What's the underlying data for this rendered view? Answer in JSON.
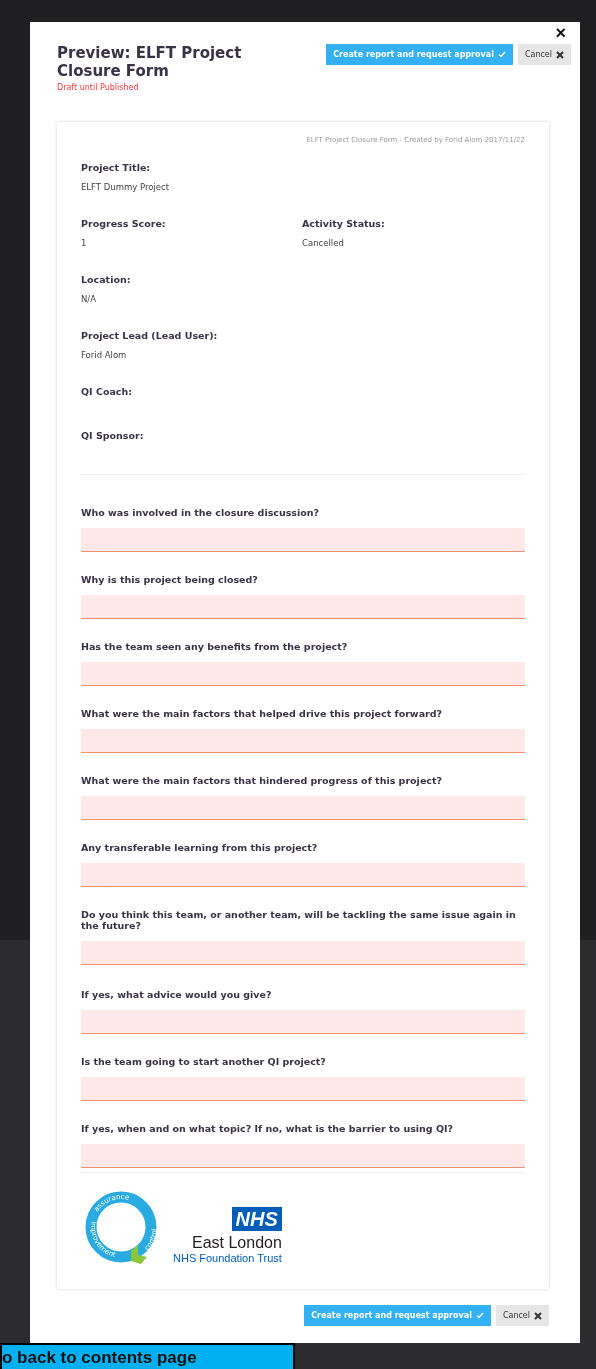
{
  "modal": {
    "title": "Preview: ELFT Project Closure Form",
    "status": "Draft until Published",
    "close": "×",
    "top_buttons": [
      {
        "label": "Create report and request approval",
        "kind": "primary"
      },
      {
        "label": "Cancel",
        "kind": "secondary"
      }
    ],
    "card": {
      "caption": "ELFT Project Closure Form - Created by Forid Alom 2017/11/22",
      "fields": [
        {
          "label": "Project Title:",
          "value": "ELFT Dummy Project"
        },
        {
          "label": "Progress Score:",
          "value": "1",
          "pair": {
            "label": "Activity Status:",
            "value": "Cancelled"
          }
        },
        {
          "label": "Location:",
          "value": "N/A"
        },
        {
          "label": "Project Lead (Lead User):",
          "value": "Forid Alom"
        },
        {
          "label": "QI Coach:"
        },
        {
          "label": "QI Sponsor:"
        }
      ],
      "questions": [
        "Who was involved in the closure discussion?",
        "Why is this project being closed?",
        "Has the team seen any benefits from the project?",
        "What were the main factors that helped drive this project forward?",
        "What were the main factors that hindered progress of this project?",
        "Any transferable learning from this project?",
        "Do you think this team, or another team, will be tackling the same issue again in the future?",
        "If yes, what advice would you give?",
        "Is the team going to start another QI project?",
        "If yes, when and on what topic? If no, what is the barrier to using QI?"
      ],
      "logo": {
        "ring_words": [
          "assurance",
          "improvement",
          "control"
        ],
        "badge": "NHS",
        "org": "East London",
        "trust": "NHS Foundation Trust"
      }
    },
    "bottom_buttons": [
      {
        "label": "Create report and request approval",
        "kind": "primary"
      },
      {
        "label": "Cancel",
        "kind": "secondary"
      }
    ]
  },
  "banner": {
    "label": "o back to contents page"
  }
}
